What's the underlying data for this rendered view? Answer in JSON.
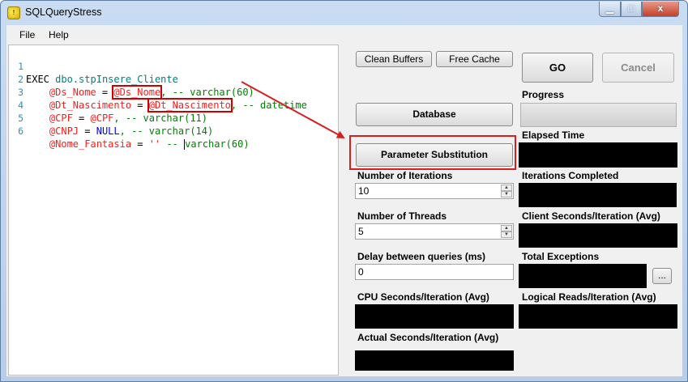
{
  "window": {
    "title": "SQLQueryStress",
    "icon": "sqlquerystress-app-icon",
    "controls": {
      "minimize": "▁",
      "maximize": "□",
      "close": "x"
    }
  },
  "menu": {
    "file": "File",
    "help": "Help"
  },
  "editor": {
    "line_numbers": [
      "1",
      "2",
      "3",
      "4",
      "5",
      "6"
    ],
    "line1": {
      "kw": "EXEC",
      "obj": "dbo.stpInsere_Cliente"
    },
    "line2": {
      "param": "@Ds_Nome",
      "eq": " = ",
      "value": "@Ds_Nome",
      "comment": ", -- varchar(60)"
    },
    "line3": {
      "param": "@Dt_Nascimento",
      "eq": " = ",
      "value": "@Dt_Nascimento",
      "comment": ", -- datetime"
    },
    "line4": {
      "param": "@CPF",
      "eq": " = ",
      "value": "@CPF",
      "comment": ", -- varchar(11)"
    },
    "line5": {
      "param": "@CNPJ",
      "eq": " = ",
      "value": "NULL",
      "comment": ", -- varchar(14)"
    },
    "line6": {
      "param": "@Nome_Fantasia",
      "eq": " = ",
      "value": "''",
      "comment_a": " -- ",
      "comment_b": "varchar(60)"
    }
  },
  "buttons": {
    "clean_buffers": "Clean Buffers",
    "free_cache": "Free Cache",
    "go": "GO",
    "cancel": "Cancel",
    "database": "Database",
    "parameter_substitution": "Parameter Substitution",
    "exceptions_more": "..."
  },
  "labels": {
    "progress": "Progress",
    "elapsed_time": "Elapsed Time",
    "number_of_iterations": "Number of Iterations",
    "iterations_completed": "Iterations Completed",
    "number_of_threads": "Number of Threads",
    "client_seconds": "Client Seconds/Iteration (Avg)",
    "delay_between_queries": "Delay between queries (ms)",
    "total_exceptions": "Total Exceptions",
    "cpu_seconds": "CPU Seconds/Iteration (Avg)",
    "logical_reads": "Logical Reads/Iteration (Avg)",
    "actual_seconds": "Actual Seconds/Iteration (Avg)"
  },
  "inputs": {
    "iterations": "10",
    "threads": "5",
    "delay": "0"
  },
  "progress": {
    "fraction": 0
  },
  "annotation": {
    "color": "#d42020"
  }
}
